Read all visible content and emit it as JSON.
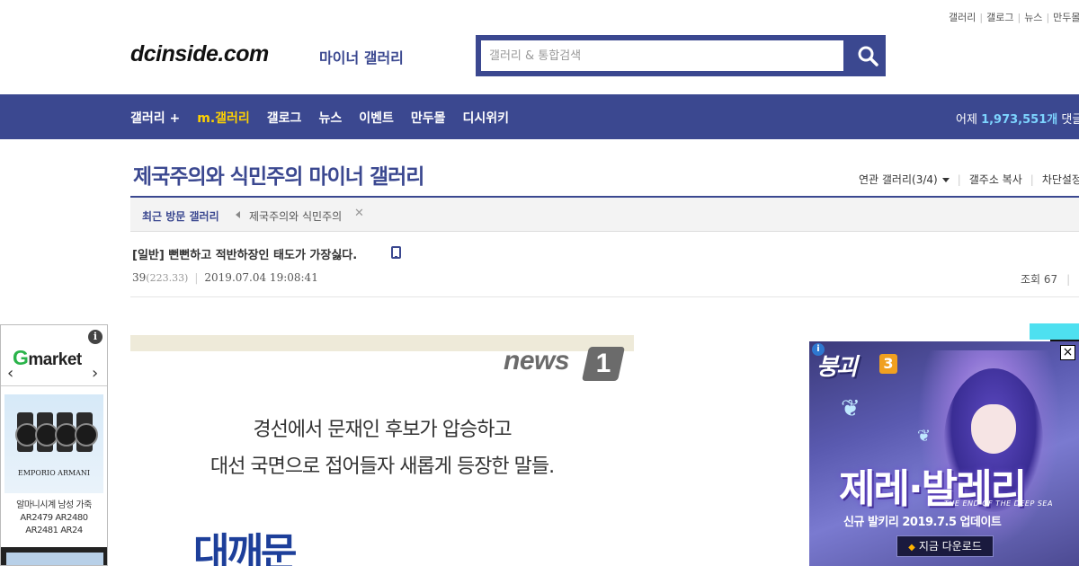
{
  "util_links": [
    "갤러리",
    "갤로그",
    "뉴스",
    "만두몰"
  ],
  "logo": {
    "main": "dcinside.com",
    "sub": "마이너 갤러리"
  },
  "search": {
    "placeholder": "갤러리 & 통합검색",
    "icon": "search-icon"
  },
  "nav": {
    "items": [
      "갤러리 +",
      "m.갤러리",
      "갤로그",
      "뉴스",
      "이벤트",
      "만두몰",
      "디시위키"
    ],
    "highlight_index": 1,
    "right_prefix": "어제",
    "right_count": "1,973,551개",
    "right_suffix": "댓글"
  },
  "gallery": {
    "title": "제국주의와 식민주의 마이너 갤러리",
    "tools": {
      "related": "연관 갤러리(3/4)",
      "copy_addr": "갤주소 복사",
      "block": "차단설정"
    },
    "recent_label": "최근 방문 갤러리",
    "recent_item": "제국주의와 식민주의"
  },
  "post": {
    "title": "[일반] 뻔뻔하고 적반하장인 태도가 가장싫다.",
    "author": "39",
    "ip": "(223.33)",
    "date": "2019.07.04 19:08:41",
    "views": "조회 67"
  },
  "left_ad": {
    "brand": "Gmarket",
    "product_brand": "EMPORIO ARMANI",
    "product_text": "알마니시계 남성 가죽 AR2479 AR2480 AR2481 AR24"
  },
  "content_image": {
    "logo": "news",
    "logo_num": "1",
    "line1": "경선에서 문재인 후보가 압승하고",
    "line2": "대선 국면으로 접어들자 새롭게 등장한 말들.",
    "big": "대깨문"
  },
  "right_ad": {
    "game_logo": "붕괴",
    "game_logo_num": "3",
    "title": "제레·발레리",
    "subtitle_en": "THE END OF THE DEEP SEA",
    "update": "신규 발키리 2019.7.5 업데이트",
    "button": "지금 다운로드"
  },
  "colors": {
    "brand": "#3b4890",
    "nav_highlight": "#ffd200",
    "count": "#7dd4ff"
  }
}
